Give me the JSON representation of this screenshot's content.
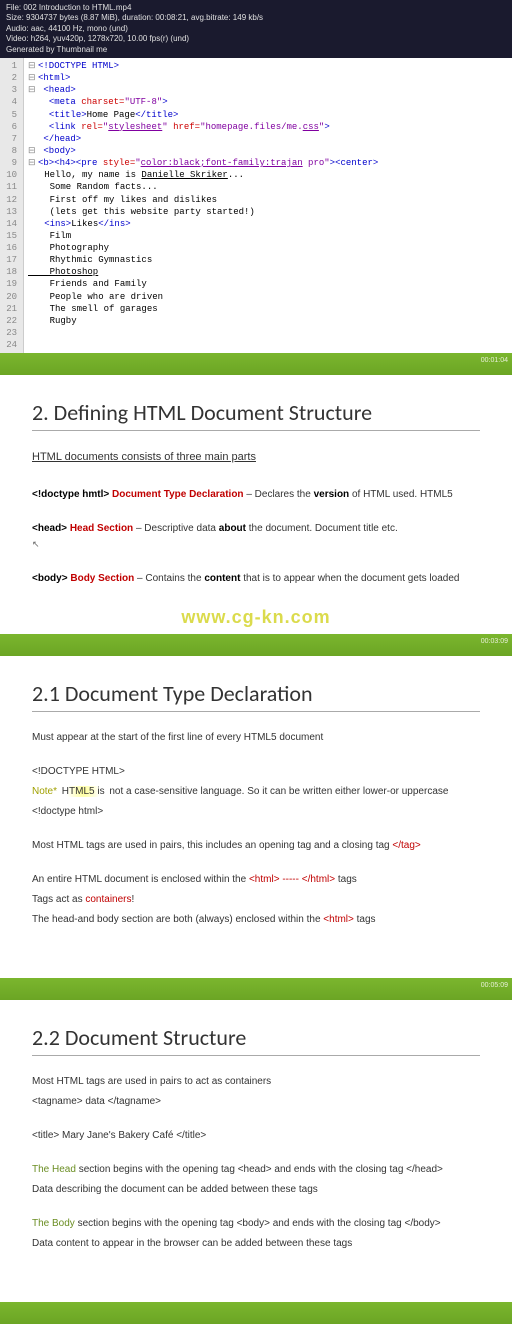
{
  "media": {
    "file": "File: 002 Introduction to HTML.mp4",
    "size": "Size: 9304737 bytes (8.87 MiB), duration: 00:08:21, avg.bitrate: 149 kb/s",
    "audio": "Audio: aac, 44100 Hz, mono (und)",
    "video": "Video: h264, yuv420p, 1278x720, 10.00 fps(r) (und)",
    "gen": "Generated by Thumbnail me"
  },
  "gutter": [
    "1",
    "2",
    "3",
    "4",
    "5",
    "6",
    "7",
    "8",
    "9",
    "10",
    "11",
    "12",
    "13",
    "14",
    "15",
    "16",
    "17",
    "18",
    "19",
    "20",
    "21",
    "22",
    "23",
    "24"
  ],
  "code": {
    "l1": "<!DOCTYPE HTML>",
    "l2": "<html>",
    "l3": "<head>",
    "l4a": "<meta ",
    "l4b": "charset=",
    "l4c": "\"UTF-8\"",
    "l4d": ">",
    "l5a": "<title>",
    "l5b": "Home Page",
    "l5c": "</title>",
    "l6a": "<link ",
    "l6b": "rel=",
    "l6c": "\"",
    "l6d": "stylesheet",
    "l6e": "\" ",
    "l6f": "href=",
    "l6g": "\"homepage.files/me.",
    "l6h": "css",
    "l6i": "\"",
    "l6j": ">",
    "l7": "</head>",
    "l8": "<body>",
    "l9a": "<b><h4><pre ",
    "l9b": "style=",
    "l9c": "\"",
    "l9d": "color:black;font-family:trajan",
    "l9e": " pro\"",
    "l9f": "><center>",
    "l10a": "   Hello, my name is ",
    "l10b": "Danielle Skriker",
    "l10c": "...",
    "l11": "    Some Random facts...",
    "l12": "    First off my likes and dislikes",
    "l13": "    (lets get this website party started!)",
    "l14": "",
    "l15a": "   <ins>",
    "l15b": "Likes",
    "l15c": "</ins>",
    "l16": "    Film",
    "l17": "    Photography",
    "l18": "    Rhythmic Gymnastics",
    "l19": "    Photoshop",
    "l20": "    Friends and Family",
    "l21": "    People who are driven",
    "l22": "    The smell of garages",
    "l23": "    Rugby",
    "l24": ""
  },
  "band1_ts": "00:01:04",
  "slide1": {
    "title": "2. Defining HTML Document Structure",
    "subtitle": "HTML documents consists of three main parts",
    "row1": {
      "tag": "<!doctype hmtl>",
      "name": "Document Type Declaration",
      "desc1": " – Declares the ",
      "bold": "version",
      "desc2": " of HTML used. HTML5"
    },
    "row2": {
      "tag": "<head>",
      "name": "Head Section",
      "desc1": " – Descriptive data ",
      "bold": "about",
      "desc2": " the document. Document title etc."
    },
    "row3": {
      "tag": "<body>",
      "name": "Body Section",
      "desc1": " – Contains the ",
      "bold": "content",
      "desc2": " that is to appear when the document gets loaded"
    }
  },
  "watermark": "www.cg-kn.com",
  "band2_ts": "00:03:09",
  "slide2": {
    "title": "2.1 Document Type Declaration",
    "p1": "Must appear at the start of the first line of every HTML5 document",
    "p2": "<!DOCTYPE HTML>",
    "p3a": "Note* ",
    "p3b": "HTML5 is",
    "p3c": " not a case-sensitive language. So it can be written either lower-or uppercase",
    "p4": "<!doctype html>",
    "p5a": "Most HTML tags are used in pairs, this includes an opening tag and a closing tag    ",
    "p5b": "</tag>",
    "p6a": "An entire HTML document is enclosed within the ",
    "p6b": "<html> ----- </html>",
    "p6c": " tags",
    "p7a": "Tags act as ",
    "p7b": "containers",
    "p7c": "!",
    "p8a": "The head-and body section are both (always) enclosed within the ",
    "p8b": "<html>",
    "p8c": " tags"
  },
  "band3_ts": "00:05:09",
  "slide3": {
    "title": "2.2 Document Structure",
    "p1": "Most HTML tags are used in pairs to act as containers",
    "p2": "<tagname>            data        </tagname>",
    "p3": "<title> Mary Jane's Bakery Café </title>",
    "p4a": "The Head",
    "p4b": " section begins with the opening tag <head> and ends with the closing tag </head>",
    "p5": "Data describing the document can be added between these tags",
    "p6a": "The Body",
    "p6b": " section begins with the opening tag <body> and ends with the closing tag </body>",
    "p7": "Data content to appear in the browser can be added between these tags"
  }
}
